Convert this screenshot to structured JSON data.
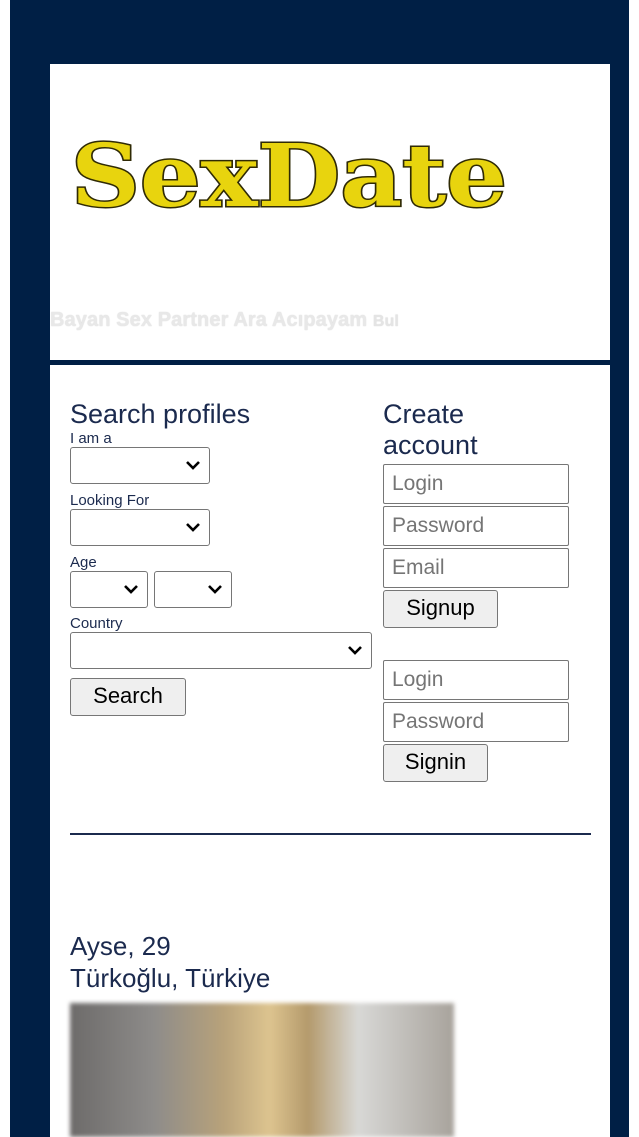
{
  "logo": {
    "text": "SexDate",
    "fill_color": "#e8d40e",
    "stroke_color": "#2f2a05"
  },
  "tagline": {
    "main": "Bayan Sex Partner Ara Acıpayam",
    "suffix": "Bul"
  },
  "search": {
    "heading": "Search profiles",
    "iam_label": "I am a",
    "looking_label": "Looking For",
    "age_label": "Age",
    "country_label": "Country",
    "button": "Search"
  },
  "create": {
    "heading_line1": "Create",
    "heading_line2": "account",
    "login_placeholder": "Login",
    "password_placeholder": "Password",
    "email_placeholder": "Email",
    "signup_button": "Signup"
  },
  "signin": {
    "login_placeholder": "Login",
    "password_placeholder": "Password",
    "signin_button": "Signin"
  },
  "profile": {
    "name_age": "Ayse, 29",
    "location": "Türkoğlu, Türkiye"
  },
  "colors": {
    "frame": "#001f45",
    "text": "#1b2a4e"
  }
}
